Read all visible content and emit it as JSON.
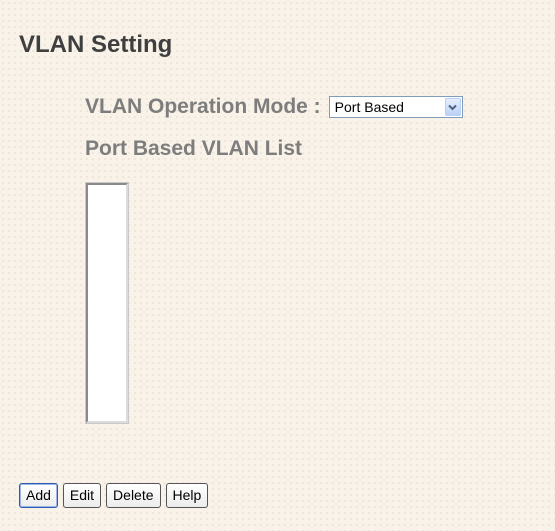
{
  "page": {
    "title": "VLAN Setting"
  },
  "vlan_mode": {
    "label": "VLAN Operation Mode :",
    "selected_value": "Port Based",
    "dropdown_icon": "chevron-down-icon"
  },
  "vlan_list": {
    "label": "Port Based VLAN List",
    "items": []
  },
  "buttons": {
    "add": "Add",
    "edit": "Edit",
    "delete": "Delete",
    "help": "Help"
  },
  "colors": {
    "background": "#f9f2e8",
    "title_text": "#3f3f3f",
    "label_text": "#7d7d7d",
    "select_border": "#7f9db9",
    "focus_border": "#2b5bb5"
  }
}
